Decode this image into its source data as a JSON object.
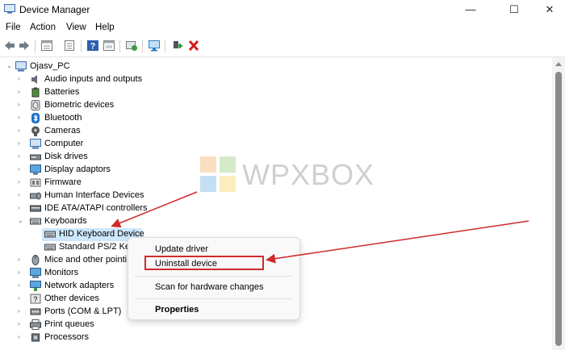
{
  "window": {
    "title": "Device Manager",
    "controls": {
      "minimize": "—",
      "maximize": "☐",
      "close": "✕"
    }
  },
  "menu": [
    "File",
    "Action",
    "View",
    "Help"
  ],
  "toolbar": {
    "icons": [
      "back-icon",
      "forward-icon",
      "properties-sheet-icon",
      "show-hide-icon",
      "help-icon",
      "device-list-icon",
      "update-driver-icon",
      "scan-hardware-icon",
      "add-legacy-icon",
      "uninstall-icon"
    ]
  },
  "tree": {
    "root": "Ojasv_PC",
    "items": [
      {
        "label": "Audio inputs and outputs",
        "icon": "speaker-icon"
      },
      {
        "label": "Batteries",
        "icon": "battery-icon"
      },
      {
        "label": "Biometric devices",
        "icon": "fingerprint-icon"
      },
      {
        "label": "Bluetooth",
        "icon": "bluetooth-icon"
      },
      {
        "label": "Cameras",
        "icon": "camera-icon"
      },
      {
        "label": "Computer",
        "icon": "monitor-icon"
      },
      {
        "label": "Disk drives",
        "icon": "disk-icon"
      },
      {
        "label": "Display adaptors",
        "icon": "display-adapter-icon"
      },
      {
        "label": "Firmware",
        "icon": "firmware-icon"
      },
      {
        "label": "Human Interface Devices",
        "icon": "hid-icon"
      },
      {
        "label": "IDE ATA/ATAPI controllers",
        "icon": "ide-icon"
      },
      {
        "label": "Keyboards",
        "icon": "keyboard-icon",
        "expanded": true
      },
      {
        "label": "HID Keyboard Device",
        "icon": "keyboard-icon",
        "child": true,
        "selected": true
      },
      {
        "label": "Standard PS/2 Key",
        "icon": "keyboard-icon",
        "child": true
      },
      {
        "label": "Mice and other pointi",
        "icon": "mouse-icon"
      },
      {
        "label": "Monitors",
        "icon": "monitor-icon"
      },
      {
        "label": "Network adapters",
        "icon": "network-icon"
      },
      {
        "label": "Other devices",
        "icon": "other-device-icon"
      },
      {
        "label": "Ports (COM & LPT)",
        "icon": "port-icon"
      },
      {
        "label": "Print queues",
        "icon": "printer-icon"
      },
      {
        "label": "Processors",
        "icon": "processor-icon"
      }
    ]
  },
  "context_menu": {
    "items": [
      "Update driver",
      "Uninstall device",
      "Scan for hardware changes",
      "Properties"
    ],
    "highlighted": "Uninstall device"
  },
  "watermark": "WPXBOX",
  "colors": {
    "selection": "#cce8ff",
    "annotation_red": "#d02a2a",
    "accent_blue": "#1a73c8"
  }
}
